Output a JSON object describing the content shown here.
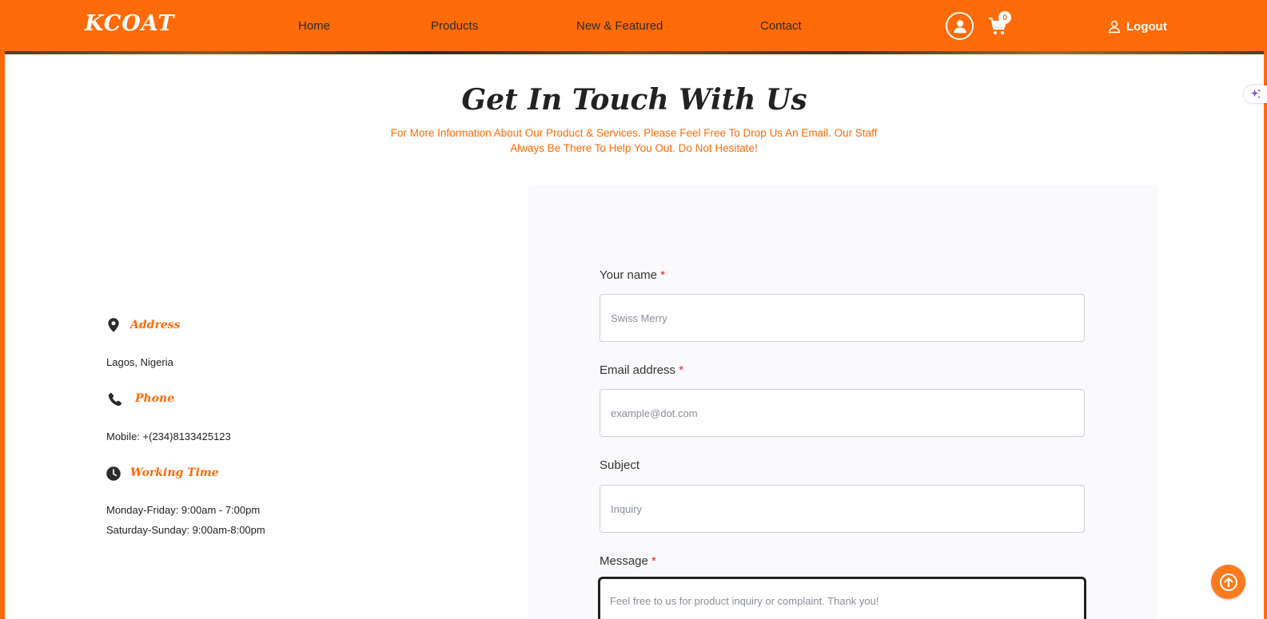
{
  "nav": {
    "logo": "KCOAT",
    "links": [
      "Home",
      "Products",
      "New & Featured",
      "Contact"
    ],
    "cart_count": "0",
    "logout_label": "Logout"
  },
  "contact": {
    "title": "Get In Touch With Us",
    "subtitle": "For More Information About Our Product & Services. Please Feel Free To Drop Us An Email. Our Staff Always Be There To Help You Out. Do Not Hesitate!",
    "address_heading": "Address",
    "address_value": "Lagos, Nigeria",
    "phone_heading": "Phone",
    "phone_value": "Mobile: +(234)8133425123",
    "hours_heading": "Working Time",
    "hours_weekday": "Monday-Friday: 9:00am - 7:00pm",
    "hours_weekend": "Saturday-Sunday: 9:00am-8:00pm"
  },
  "form": {
    "name_label": "Your name",
    "name_placeholder": "Swiss Merry",
    "email_label": "Email address",
    "email_placeholder": "example@dot.com",
    "subject_label": "Subject",
    "subject_placeholder": "Inquiry",
    "message_label": "Message",
    "message_placeholder": "Feel free to us for product inquiry or complaint. Thank you!",
    "required_mark": "*"
  },
  "colors": {
    "brand": "#ff6b08",
    "required": "#e02424"
  }
}
